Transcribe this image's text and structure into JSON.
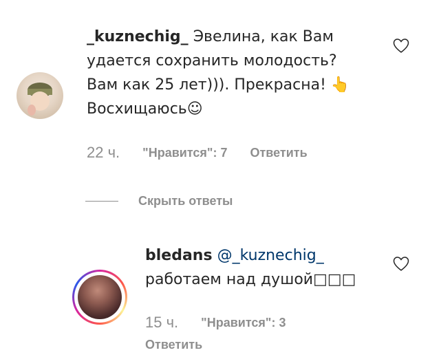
{
  "comment1": {
    "username": "_kuznechig_",
    "text_lines": [
      "Эвелина, как Вам",
      "удается сохранить молодость?",
      "Вам как 25 лет))). Прекрасна! 👆",
      "Восхищаюсь☺"
    ],
    "time": "22 ч.",
    "likes": "\"Нравится\": 7",
    "reply": "Ответить"
  },
  "hide_replies": "Скрыть ответы",
  "comment2": {
    "username": "bledans",
    "mention": "@_kuznechig_",
    "text": "работаем над душой□□□",
    "time": "15 ч.",
    "likes": "\"Нравится\": 3",
    "reply": "Ответить"
  },
  "icons": {
    "like1": "heart-outline-icon",
    "like2": "heart-outline-icon"
  },
  "colors": {
    "text": "#262626",
    "meta": "#8e8e8e",
    "mention": "#00376b"
  }
}
